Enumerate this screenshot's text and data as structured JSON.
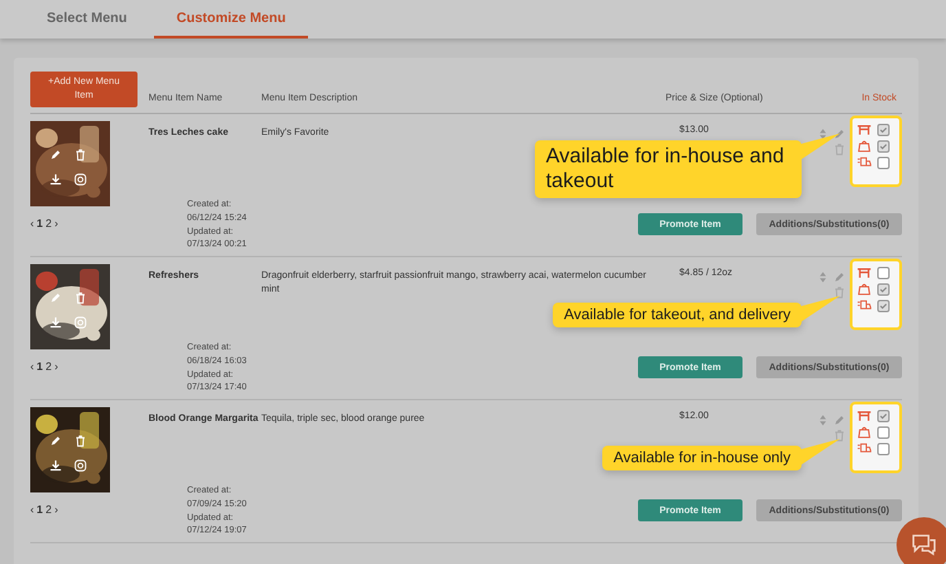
{
  "tabs": [
    {
      "label": "Select Menu",
      "selected": false
    },
    {
      "label": "Customize Menu",
      "selected": true
    }
  ],
  "add_button": "+Add New Menu Item",
  "columns": [
    "Menu Item Name",
    "Menu Item Description",
    "Price & Size (Optional)",
    "In Stock"
  ],
  "rows": [
    {
      "name": "Tres Leches cake",
      "description": "Emily's Favorite",
      "price": "$13.00",
      "pages": [
        "‹",
        "1",
        "2",
        "›"
      ],
      "created_label": "Created at:",
      "created": "06/12/24 15:24",
      "updated_label": "Updated at:",
      "updated": "07/13/24 00:21",
      "promote": "Promote Item",
      "additions": "Additions/Substitutions(0)",
      "stock": [
        {
          "kind": "in_house",
          "checked": true
        },
        {
          "kind": "takeout",
          "checked": true
        },
        {
          "kind": "delivery",
          "checked": false
        }
      ],
      "callout": {
        "kind": "large",
        "text": "Available for in-house and takeout"
      }
    },
    {
      "name": "Refreshers",
      "description": "Dragonfruit elderberry, starfruit passionfruit mango, strawberry acai, watermelon cucumber mint",
      "price": "$4.85 / 12oz",
      "pages": [
        "‹",
        "1",
        "2",
        "›"
      ],
      "created_label": "Created at:",
      "created": "06/18/24 16:03",
      "updated_label": "Updated at:",
      "updated": "07/13/24 17:40",
      "promote": "Promote Item",
      "additions": "Additions/Substitutions(0)",
      "stock": [
        {
          "kind": "in_house",
          "checked": false
        },
        {
          "kind": "takeout",
          "checked": true
        },
        {
          "kind": "delivery",
          "checked": true
        }
      ],
      "callout": {
        "kind": "small",
        "text": "Available for takeout, and delivery"
      }
    },
    {
      "name": "Blood Orange Margarita",
      "description": "Tequila, triple sec, blood orange puree",
      "price": "$12.00",
      "pages": [
        "‹",
        "1",
        "2",
        "›"
      ],
      "created_label": "Created at:",
      "created": "07/09/24 15:20",
      "updated_label": "Updated at:",
      "updated": "07/12/24 19:07",
      "promote": "Promote Item",
      "additions": "Additions/Substitutions(0)",
      "stock": [
        {
          "kind": "in_house",
          "checked": true
        },
        {
          "kind": "takeout",
          "checked": false
        },
        {
          "kind": "delivery",
          "checked": false
        }
      ],
      "callout": {
        "kind": "small",
        "text": "Available for in-house only"
      }
    }
  ]
}
